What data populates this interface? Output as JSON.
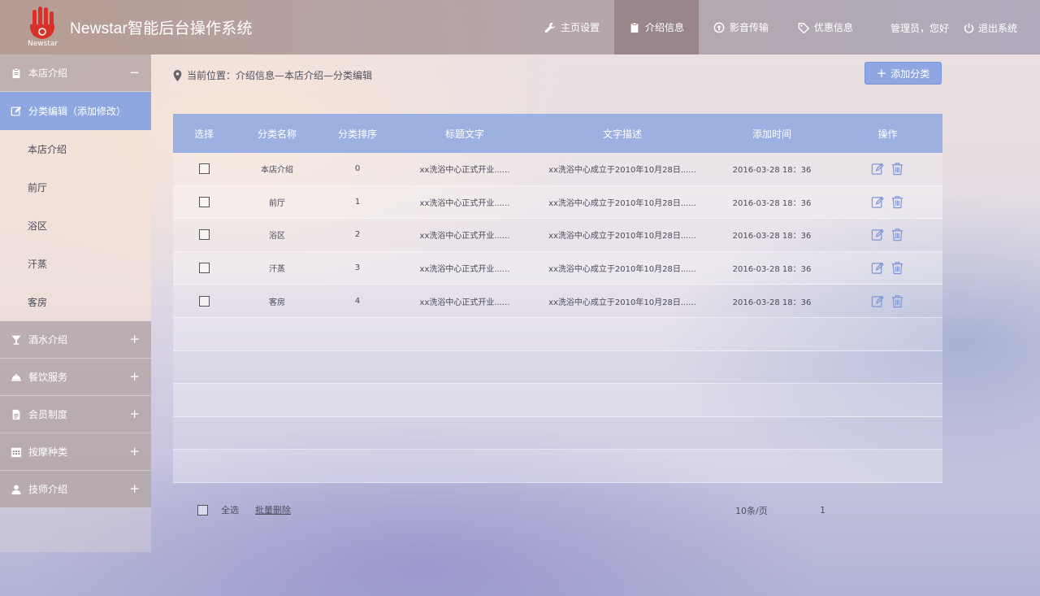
{
  "brand": {
    "logo_text": "Newstar",
    "title": "Newstar智能后台操作系统",
    "logo_color": "#d7312a"
  },
  "nav": {
    "items": [
      {
        "label": "主页设置",
        "icon": "wrench-icon"
      },
      {
        "label": "介绍信息",
        "icon": "clipboard-icon"
      },
      {
        "label": "影音传输",
        "icon": "upload-icon"
      },
      {
        "label": "优惠信息",
        "icon": "tag-icon"
      }
    ],
    "greeting": "管理员，您好",
    "logout": "退出系统"
  },
  "sidebar": {
    "groups": [
      {
        "label": "本店介绍",
        "toggle": "−",
        "icon": "clipboard-icon"
      },
      {
        "label": "酒水介绍",
        "toggle": "+",
        "icon": "cocktail-icon"
      },
      {
        "label": "餐饮服务",
        "toggle": "+",
        "icon": "cloche-icon"
      },
      {
        "label": "会员制度",
        "toggle": "+",
        "icon": "document-icon"
      },
      {
        "label": "按摩种类",
        "toggle": "+",
        "icon": "calendar-icon"
      },
      {
        "label": "技师介绍",
        "toggle": "+",
        "icon": "user-icon"
      }
    ],
    "subitems": [
      {
        "label": "分类编辑（添加修改）",
        "icon": "edit-icon"
      },
      {
        "label": "本店介绍"
      },
      {
        "label": "前厅"
      },
      {
        "label": "浴区"
      },
      {
        "label": "汗蒸"
      },
      {
        "label": "客房"
      }
    ]
  },
  "breadcrumb": "当前位置：介绍信息—本店介绍—分类编辑",
  "add_button": "添加分类",
  "table": {
    "columns": [
      "选择",
      "分类名称",
      "分类排序",
      "标题文字",
      "文字描述",
      "添加时间",
      "操作"
    ],
    "rows": [
      {
        "name": "本店介绍",
        "order": "0",
        "title": "xx洗浴中心正式开业......",
        "desc": "xx洗浴中心成立于2010年10月28日......",
        "time": "2016-03-28  18：36"
      },
      {
        "name": "前厅",
        "order": "1",
        "title": "xx洗浴中心正式开业......",
        "desc": "xx洗浴中心成立于2010年10月28日......",
        "time": "2016-03-28  18：36"
      },
      {
        "name": "浴区",
        "order": "2",
        "title": "xx洗浴中心正式开业......",
        "desc": "xx洗浴中心成立于2010年10月28日......",
        "time": "2016-03-28  18：36"
      },
      {
        "name": "汗蒸",
        "order": "3",
        "title": "xx洗浴中心正式开业......",
        "desc": "xx洗浴中心成立于2010年10月28日......",
        "time": "2016-03-28  18：36"
      },
      {
        "name": "客房",
        "order": "4",
        "title": "xx洗浴中心正式开业......",
        "desc": "xx洗浴中心成立于2010年10月28日......",
        "time": "2016-03-28  18：36"
      }
    ]
  },
  "footer": {
    "select_all": "全选",
    "batch_delete": "批量删除",
    "per_page": "10条/页",
    "page": "1"
  },
  "colors": {
    "accent": "#8fa7e0",
    "icon_blue": "#7f96d6"
  }
}
